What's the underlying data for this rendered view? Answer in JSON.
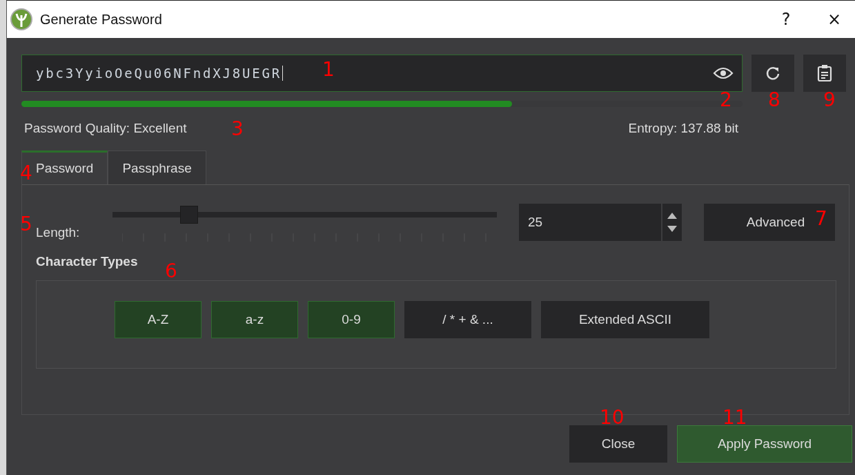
{
  "window": {
    "title": "Generate Password",
    "help": "?",
    "close": "×"
  },
  "password": {
    "value": "ybc3YyioOeQu06NFndXJ8UEGR",
    "strength": {
      "level": 0.68
    }
  },
  "quality": "Password Quality: Excellent",
  "entropy": "Entropy: 137.88 bit",
  "tabs": [
    {
      "label": "Password",
      "selected": true
    },
    {
      "label": "Passphrase",
      "selected": false
    }
  ],
  "length": {
    "label": "Length:",
    "level": 0.2,
    "value": "25"
  },
  "advanced_button": "Advanced",
  "character_types": {
    "title": "Character Types",
    "options": [
      {
        "label": "A-Z",
        "checked": true
      },
      {
        "label": "a-z",
        "checked": true
      },
      {
        "label": "0-9",
        "checked": true
      },
      {
        "label": "/ * + & ...",
        "checked": false
      },
      {
        "label": "Extended ASCII",
        "checked": false
      }
    ]
  },
  "buttons": [
    {
      "label": "Close",
      "kind": "plain"
    },
    {
      "label": "Apply Password",
      "kind": "primary"
    }
  ],
  "annotations": [
    "1",
    "2",
    "3",
    "4",
    "5",
    "6",
    "7",
    "8",
    "9",
    "10",
    "11"
  ]
}
